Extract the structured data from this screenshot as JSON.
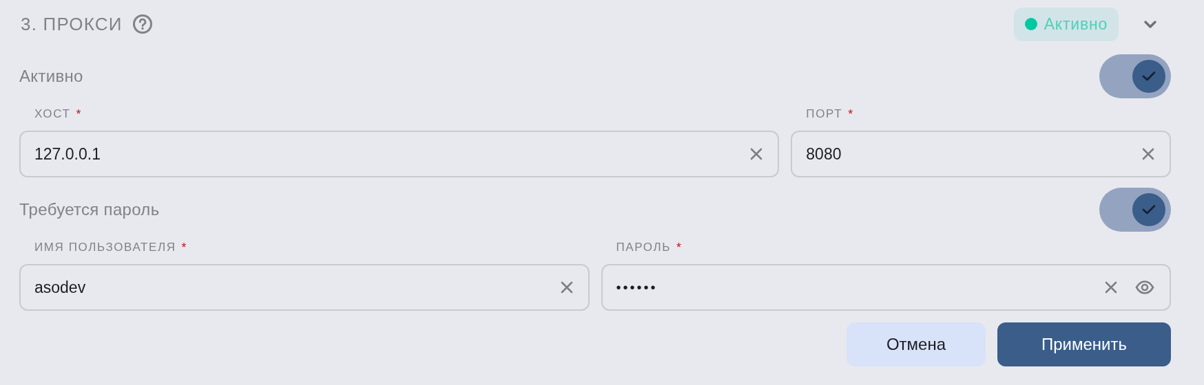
{
  "header": {
    "title": "3. ПРОКСИ",
    "status_badge": {
      "label": "Активно",
      "color": "#00c9a0"
    },
    "expanded": true
  },
  "rows": [
    {
      "kind": "toggle",
      "label": "Активно",
      "on": true
    },
    {
      "kind": "fields",
      "fields": [
        {
          "label": "ХОСТ",
          "required_mark": "*",
          "value": "127.0.0.1",
          "kind": "text"
        },
        {
          "label": "ПОРТ",
          "required_mark": "*",
          "value": "8080",
          "kind": "text"
        }
      ]
    },
    {
      "kind": "toggle",
      "label": "Требуется пароль",
      "on": true
    },
    {
      "kind": "fields",
      "fields": [
        {
          "label": "ИМЯ ПОЛЬЗОВАТЕЛЯ",
          "required_mark": "*",
          "value": "asodev",
          "kind": "text"
        },
        {
          "label": "ПАРОЛЬ",
          "required_mark": "*",
          "value": "••••••",
          "kind": "password"
        }
      ]
    }
  ],
  "buttons": [
    {
      "label": "Отмена",
      "kind": "secondary"
    },
    {
      "label": "Применить",
      "kind": "primary"
    }
  ]
}
